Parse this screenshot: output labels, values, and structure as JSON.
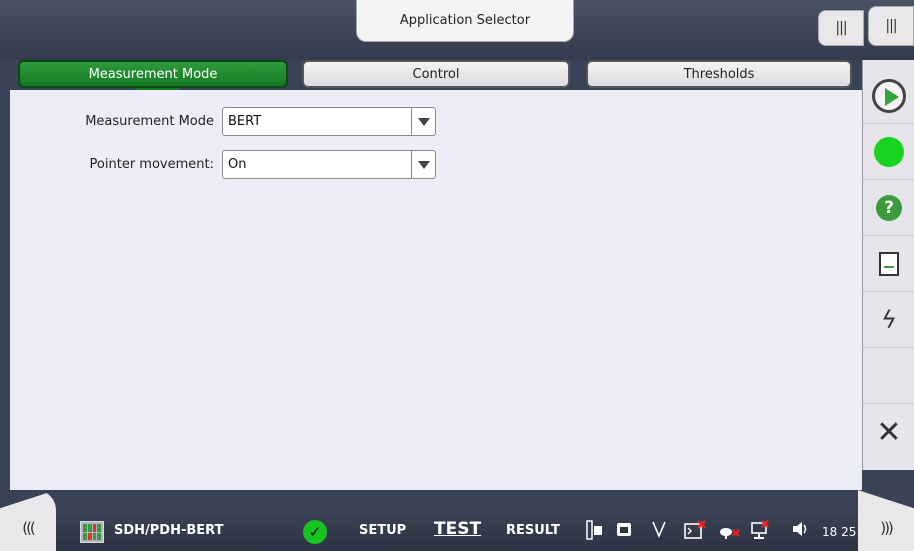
{
  "header": {
    "app_selector_label": "Application Selector",
    "grip_icon_1": "|||",
    "grip_icon_2": "|||"
  },
  "tabs": [
    {
      "label": "Measurement Mode",
      "active": true
    },
    {
      "label": "Control",
      "active": false
    },
    {
      "label": "Thresholds",
      "active": false
    }
  ],
  "form": {
    "measurement_mode": {
      "label": "Measurement Mode",
      "value": "BERT"
    },
    "pointer_movement": {
      "label": "Pointer movement:",
      "value": "On"
    }
  },
  "sidebar": {
    "items": [
      "play-icon",
      "status-led-icon",
      "help-icon",
      "report-icon",
      "lightning-icon",
      "close-icon"
    ],
    "help_glyph": "?",
    "close_glyph": "✕",
    "bolt_glyph": "ϟ"
  },
  "footer": {
    "left_arrow": "(((",
    "right_arrow": ")))",
    "app_name": "SDH/PDH-BERT",
    "check_glyph": "✓",
    "nav": {
      "setup": "SETUP",
      "test": "TEST",
      "result": "RESULT"
    },
    "time": "18 25"
  },
  "colors": {
    "accent_green": "#1a8a2a",
    "led_green": "#16d420",
    "panel_bg": "#ededf8"
  }
}
